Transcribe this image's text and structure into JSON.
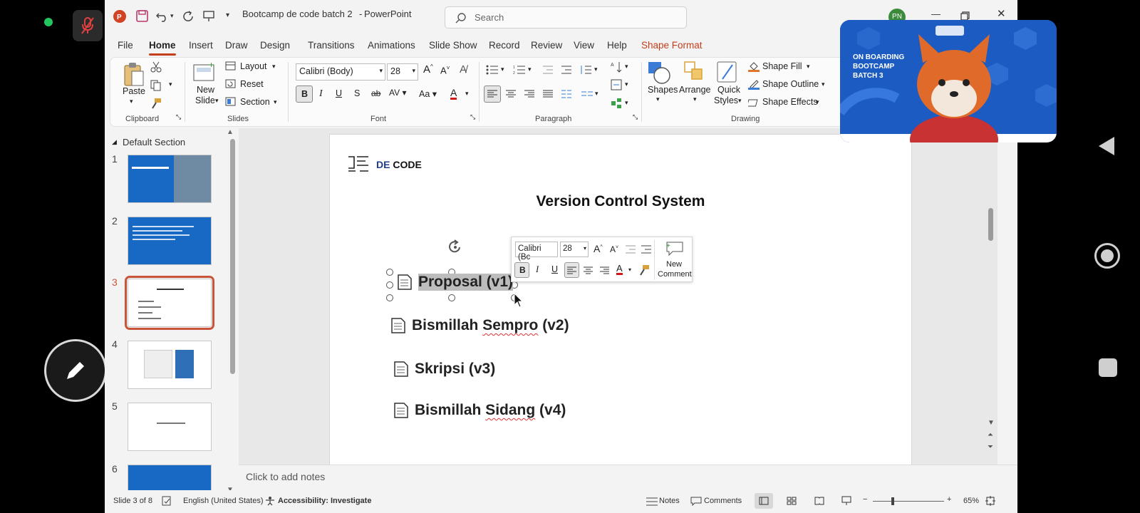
{
  "titlebar": {
    "doc_title": "Bootcamp de code batch 2",
    "app_name": "PowerPoint",
    "search_placeholder": "Search",
    "user_initials": "PN"
  },
  "menu": {
    "tabs": [
      "File",
      "Home",
      "Insert",
      "Draw",
      "Design",
      "Transitions",
      "Animations",
      "Slide Show",
      "Record",
      "Review",
      "View",
      "Help",
      "Shape Format"
    ],
    "active": "Home"
  },
  "ribbon": {
    "clipboard": {
      "label": "Clipboard",
      "paste": "Paste"
    },
    "slides": {
      "label": "Slides",
      "new_slide_1": "New",
      "new_slide_2": "Slide",
      "layout": "Layout",
      "reset": "Reset",
      "section": "Section"
    },
    "font": {
      "label": "Font",
      "family": "Calibri (Body)",
      "size": "28"
    },
    "paragraph": {
      "label": "Paragraph"
    },
    "drawing": {
      "label": "Drawing",
      "shapes": "Shapes",
      "arrange": "Arrange",
      "quick_1": "Quick",
      "quick_2": "Styles",
      "fill": "Shape Fill",
      "outline": "Shape Outline",
      "effects": "Shape Effects"
    }
  },
  "thumbnails": {
    "section": "Default Section",
    "numbers": [
      "1",
      "2",
      "3",
      "4",
      "5",
      "6"
    ],
    "selected": "3"
  },
  "slide": {
    "brand_de": "DE",
    "brand_code": "CODE",
    "title": "Version Control System",
    "bullets": [
      "Proposal (v1)",
      "Bismillah Sempro (v2)",
      "Skripsi (v3)",
      "Bismillah Sidang (v4)"
    ]
  },
  "mini_toolbar": {
    "font": "Calibri (Bc",
    "size": "28",
    "new_comment_1": "New",
    "new_comment_2": "Comment"
  },
  "notes_placeholder": "Click to add notes",
  "status": {
    "slide_of": "Slide 3 of 8",
    "language": "English (United States)",
    "accessibility": "Accessibility: Investigate",
    "notes": "Notes",
    "comments": "Comments",
    "zoom": "65%"
  },
  "video": {
    "title_lines": [
      "ON BOARDING",
      "BOOTCAMP",
      "BATCH 3"
    ]
  }
}
